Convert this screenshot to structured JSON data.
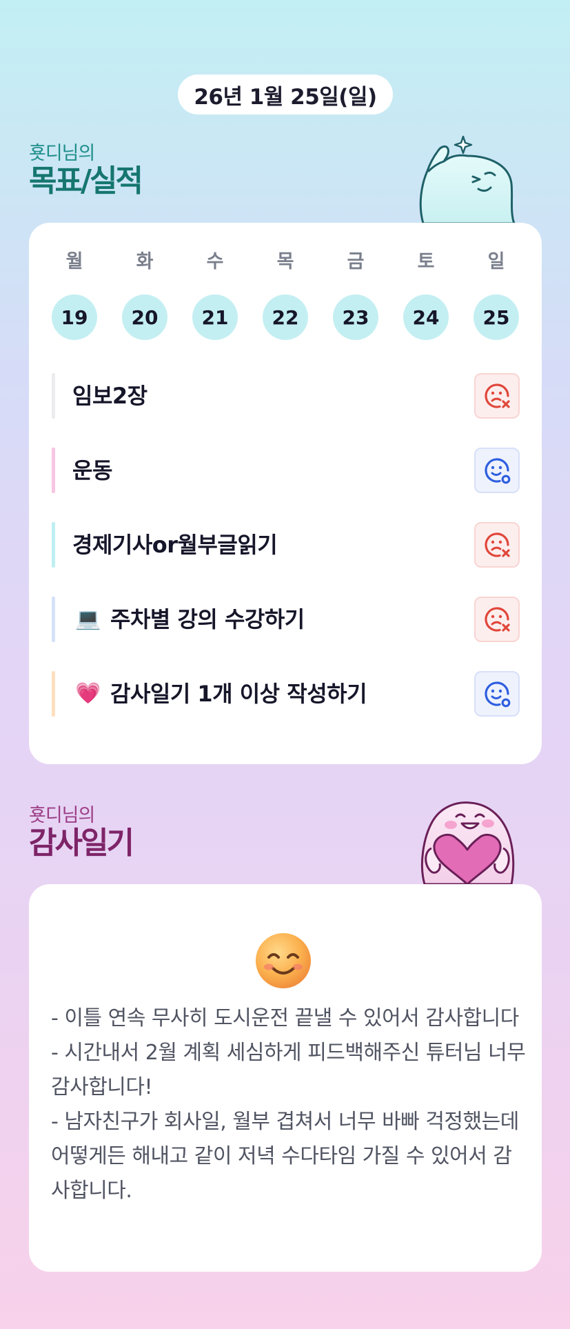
{
  "header": {
    "date": "26년 1월 25일(일)"
  },
  "goals_section": {
    "owner": "횻디님의",
    "title": "목표/실적"
  },
  "week": {
    "days": [
      {
        "name": "월",
        "num": "19"
      },
      {
        "name": "화",
        "num": "20"
      },
      {
        "name": "수",
        "num": "21"
      },
      {
        "name": "목",
        "num": "22"
      },
      {
        "name": "금",
        "num": "23"
      },
      {
        "name": "토",
        "num": "24"
      },
      {
        "name": "일",
        "num": "25"
      }
    ]
  },
  "goals": [
    {
      "label": "임보2장",
      "emoji": "",
      "status": "not-done",
      "bar_color": "#ececef"
    },
    {
      "label": "운동",
      "emoji": "",
      "status": "done",
      "bar_color": "#f8c6e2"
    },
    {
      "label": "경제기사or월부글읽기",
      "emoji": "",
      "status": "not-done",
      "bar_color": "#bfeff2"
    },
    {
      "label": "주차별 강의 수강하기",
      "emoji": "💻",
      "status": "not-done",
      "bar_color": "#d5e2f8"
    },
    {
      "label": "감사일기 1개 이상 작성하기",
      "emoji": "💗",
      "status": "done",
      "bar_color": "#fde0c0"
    }
  ],
  "status_icons": {
    "done": "smile-check-icon",
    "not-done": "sad-x-icon"
  },
  "colors": {
    "done": "#2f5fe0",
    "not_done": "#e0473a",
    "goal_accent": "#16766f",
    "gratitude_accent": "#7e2468"
  },
  "gratitude_section": {
    "owner": "횻디님의",
    "title": "감사일기"
  },
  "gratitude": {
    "emoji_icon": "smiling-face-icon",
    "lines": [
      "- 이틀 연속 무사히 도시운전 끝낼 수 있어서 감사합니다",
      "- 시간내서 2월 계획 세심하게 피드백해주신 튜터님 너무 감사합니다!",
      "- 남자친구가 회사일, 월부 겹쳐서 너무 바빠 걱정했는데 어떻게든 해내고 같이 저녁 수다타임 가질 수 있어서 감사합니다."
    ]
  }
}
